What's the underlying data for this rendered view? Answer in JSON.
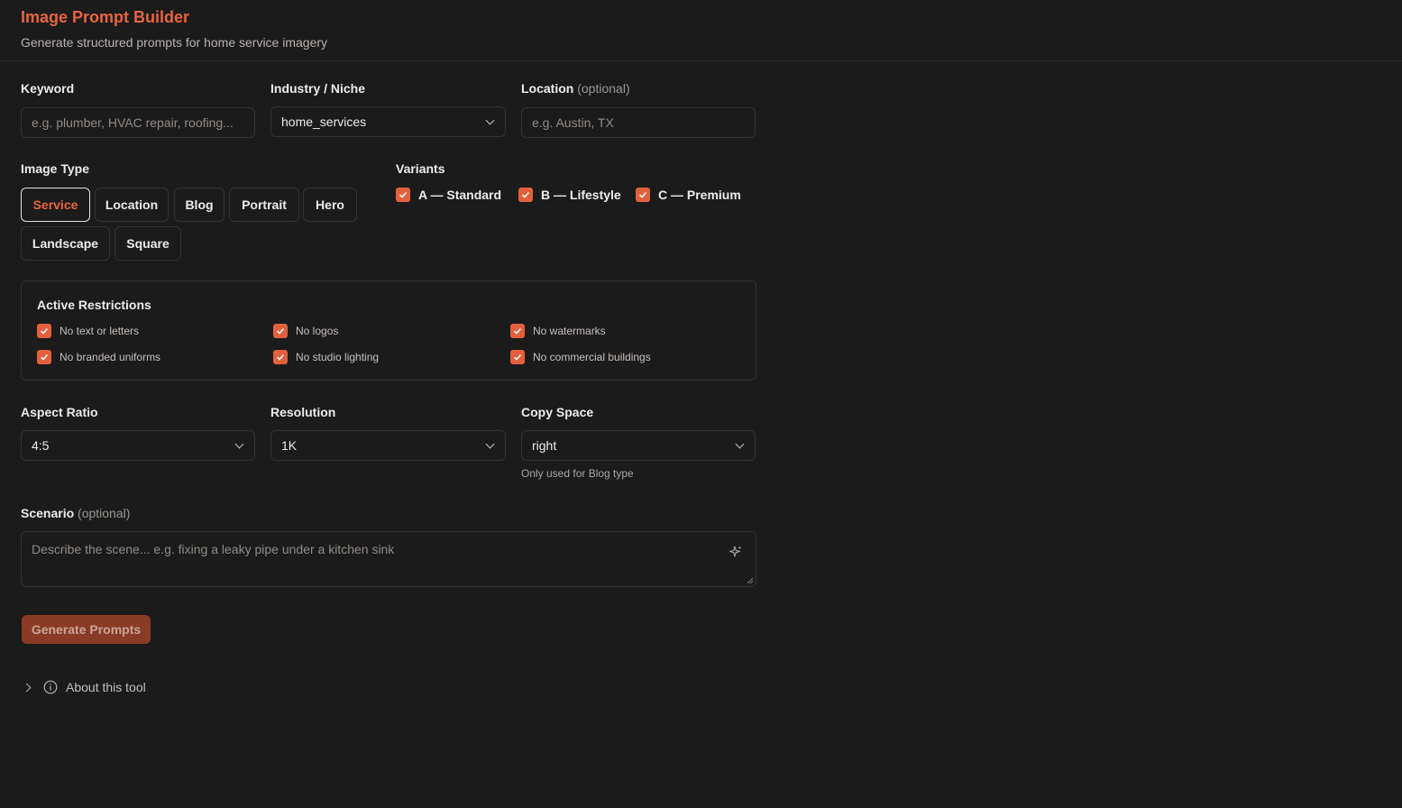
{
  "header": {
    "title": "Image Prompt Builder",
    "subtitle": "Generate structured prompts for home service imagery"
  },
  "fields": {
    "keyword": {
      "label": "Keyword",
      "placeholder": "e.g. plumber, HVAC repair, roofing..."
    },
    "industry": {
      "label": "Industry / Niche",
      "value": "home_services"
    },
    "location": {
      "label": "Location",
      "optional": "(optional)",
      "placeholder": "e.g. Austin, TX"
    }
  },
  "image_type": {
    "label": "Image Type",
    "options": [
      "Service",
      "Location",
      "Blog",
      "Portrait",
      "Hero",
      "Landscape",
      "Square"
    ],
    "selected": "Service"
  },
  "variants": {
    "label": "Variants",
    "items": [
      {
        "label": "A — Standard",
        "checked": true
      },
      {
        "label": "B — Lifestyle",
        "checked": true
      },
      {
        "label": "C — Premium",
        "checked": true
      }
    ]
  },
  "restrictions": {
    "title": "Active Restrictions",
    "items": [
      {
        "label": "No text or letters",
        "checked": true
      },
      {
        "label": "No logos",
        "checked": true
      },
      {
        "label": "No watermarks",
        "checked": true
      },
      {
        "label": "No branded uniforms",
        "checked": true
      },
      {
        "label": "No studio lighting",
        "checked": true
      },
      {
        "label": "No commercial buildings",
        "checked": true
      }
    ]
  },
  "settings": {
    "aspect_ratio": {
      "label": "Aspect Ratio",
      "value": "4:5"
    },
    "resolution": {
      "label": "Resolution",
      "value": "1K"
    },
    "copy_space": {
      "label": "Copy Space",
      "value": "right",
      "hint": "Only used for Blog type"
    }
  },
  "scenario": {
    "label": "Scenario",
    "optional": "(optional)",
    "placeholder": "Describe the scene... e.g. fixing a leaky pipe under a kitchen sink"
  },
  "actions": {
    "generate_label": "Generate Prompts"
  },
  "about": {
    "label": "About this tool"
  },
  "colors": {
    "accent": "#e8643f",
    "background": "#1c1b1b",
    "button_disabled": "#8a3b25"
  }
}
